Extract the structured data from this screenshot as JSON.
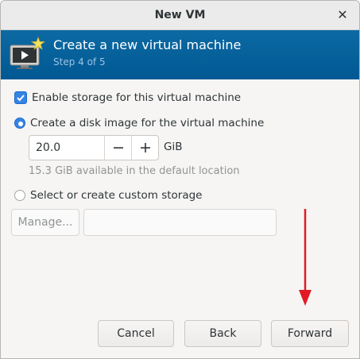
{
  "window": {
    "title": "New VM",
    "close_icon": "close-icon"
  },
  "header": {
    "title": "Create a new virtual machine",
    "step": "Step 4 of 5",
    "icon": "vm-monitor-icon"
  },
  "storage": {
    "enable_label": "Enable storage for this virtual machine",
    "enable_checked": true,
    "create_disk_label": "Create a disk image for the virtual machine",
    "create_disk_selected": true,
    "disk_size": "20.0",
    "unit": "GiB",
    "available_hint": "15.3 GiB available in the default location",
    "custom_label": "Select or create custom storage",
    "custom_selected": false,
    "manage_label": "Manage...",
    "custom_path": ""
  },
  "buttons": {
    "cancel": "Cancel",
    "back": "Back",
    "forward": "Forward"
  },
  "annotation": {
    "arrow_color": "#e01b24"
  },
  "colors": {
    "header_bg": "#005b96",
    "accent": "#3584e4"
  }
}
